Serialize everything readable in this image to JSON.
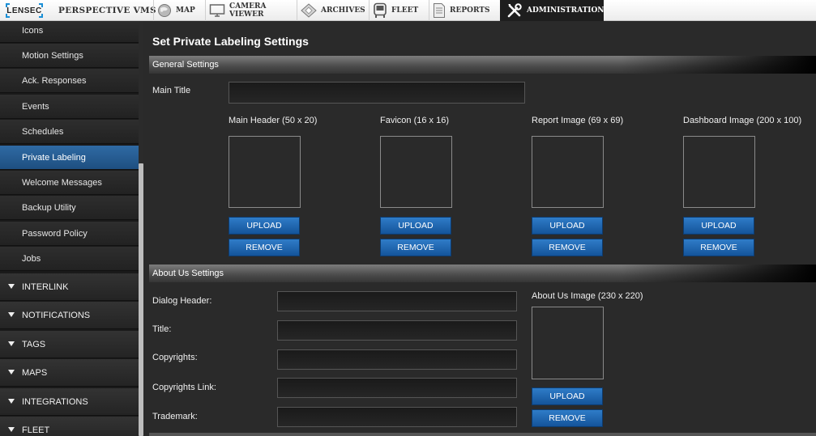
{
  "topbar": {
    "logo": "LENSEC",
    "brand": "PERSPECTIVE VMS",
    "tabs": [
      {
        "label": "MAP",
        "icon": "globe-icon"
      },
      {
        "label": "CAMERA VIEWER",
        "icon": "monitor-icon"
      },
      {
        "label": "ARCHIVES",
        "icon": "archive-icon"
      },
      {
        "label": "FLEET",
        "icon": "bus-icon"
      },
      {
        "label": "REPORTS",
        "icon": "document-icon"
      },
      {
        "label": "ADMINISTRATION",
        "icon": "tools-icon",
        "active": true
      }
    ]
  },
  "sidebar": {
    "items": [
      {
        "label": "Icons"
      },
      {
        "label": "Motion Settings"
      },
      {
        "label": "Ack. Responses"
      },
      {
        "label": "Events"
      },
      {
        "label": "Schedules"
      },
      {
        "label": "Private Labeling",
        "active": true
      },
      {
        "label": "Welcome Messages"
      },
      {
        "label": "Backup Utility"
      },
      {
        "label": "Password Policy"
      },
      {
        "label": "Jobs"
      }
    ],
    "sections": [
      {
        "label": "INTERLINK"
      },
      {
        "label": "NOTIFICATIONS"
      },
      {
        "label": "TAGS"
      },
      {
        "label": "MAPS"
      },
      {
        "label": "INTEGRATIONS"
      },
      {
        "label": "FLEET"
      }
    ]
  },
  "main": {
    "title": "Set Private Labeling Settings",
    "general": {
      "header": "General Settings",
      "main_title_label": "Main Title",
      "main_title_value": "",
      "images": [
        {
          "label": "Main Header (50 x 20)"
        },
        {
          "label": "Favicon (16 x 16)"
        },
        {
          "label": "Report Image (69 x 69)"
        },
        {
          "label": "Dashboard Image (200 x 100)"
        }
      ],
      "upload_label": "UPLOAD",
      "remove_label": "REMOVE"
    },
    "about": {
      "header": "About Us Settings",
      "fields": [
        {
          "label": "Dialog Header:",
          "value": ""
        },
        {
          "label": "Title:",
          "value": ""
        },
        {
          "label": "Copyrights:",
          "value": ""
        },
        {
          "label": "Copyrights Link:",
          "value": ""
        },
        {
          "label": "Trademark:",
          "value": ""
        }
      ],
      "image_label": "About Us Image (230 x 220)",
      "upload_label": "UPLOAD",
      "remove_label": "REMOVE"
    }
  },
  "colors": {
    "accent_blue": "#1e5f9e",
    "button_blue": "#1a63ad",
    "background": "#2a2a2a"
  }
}
